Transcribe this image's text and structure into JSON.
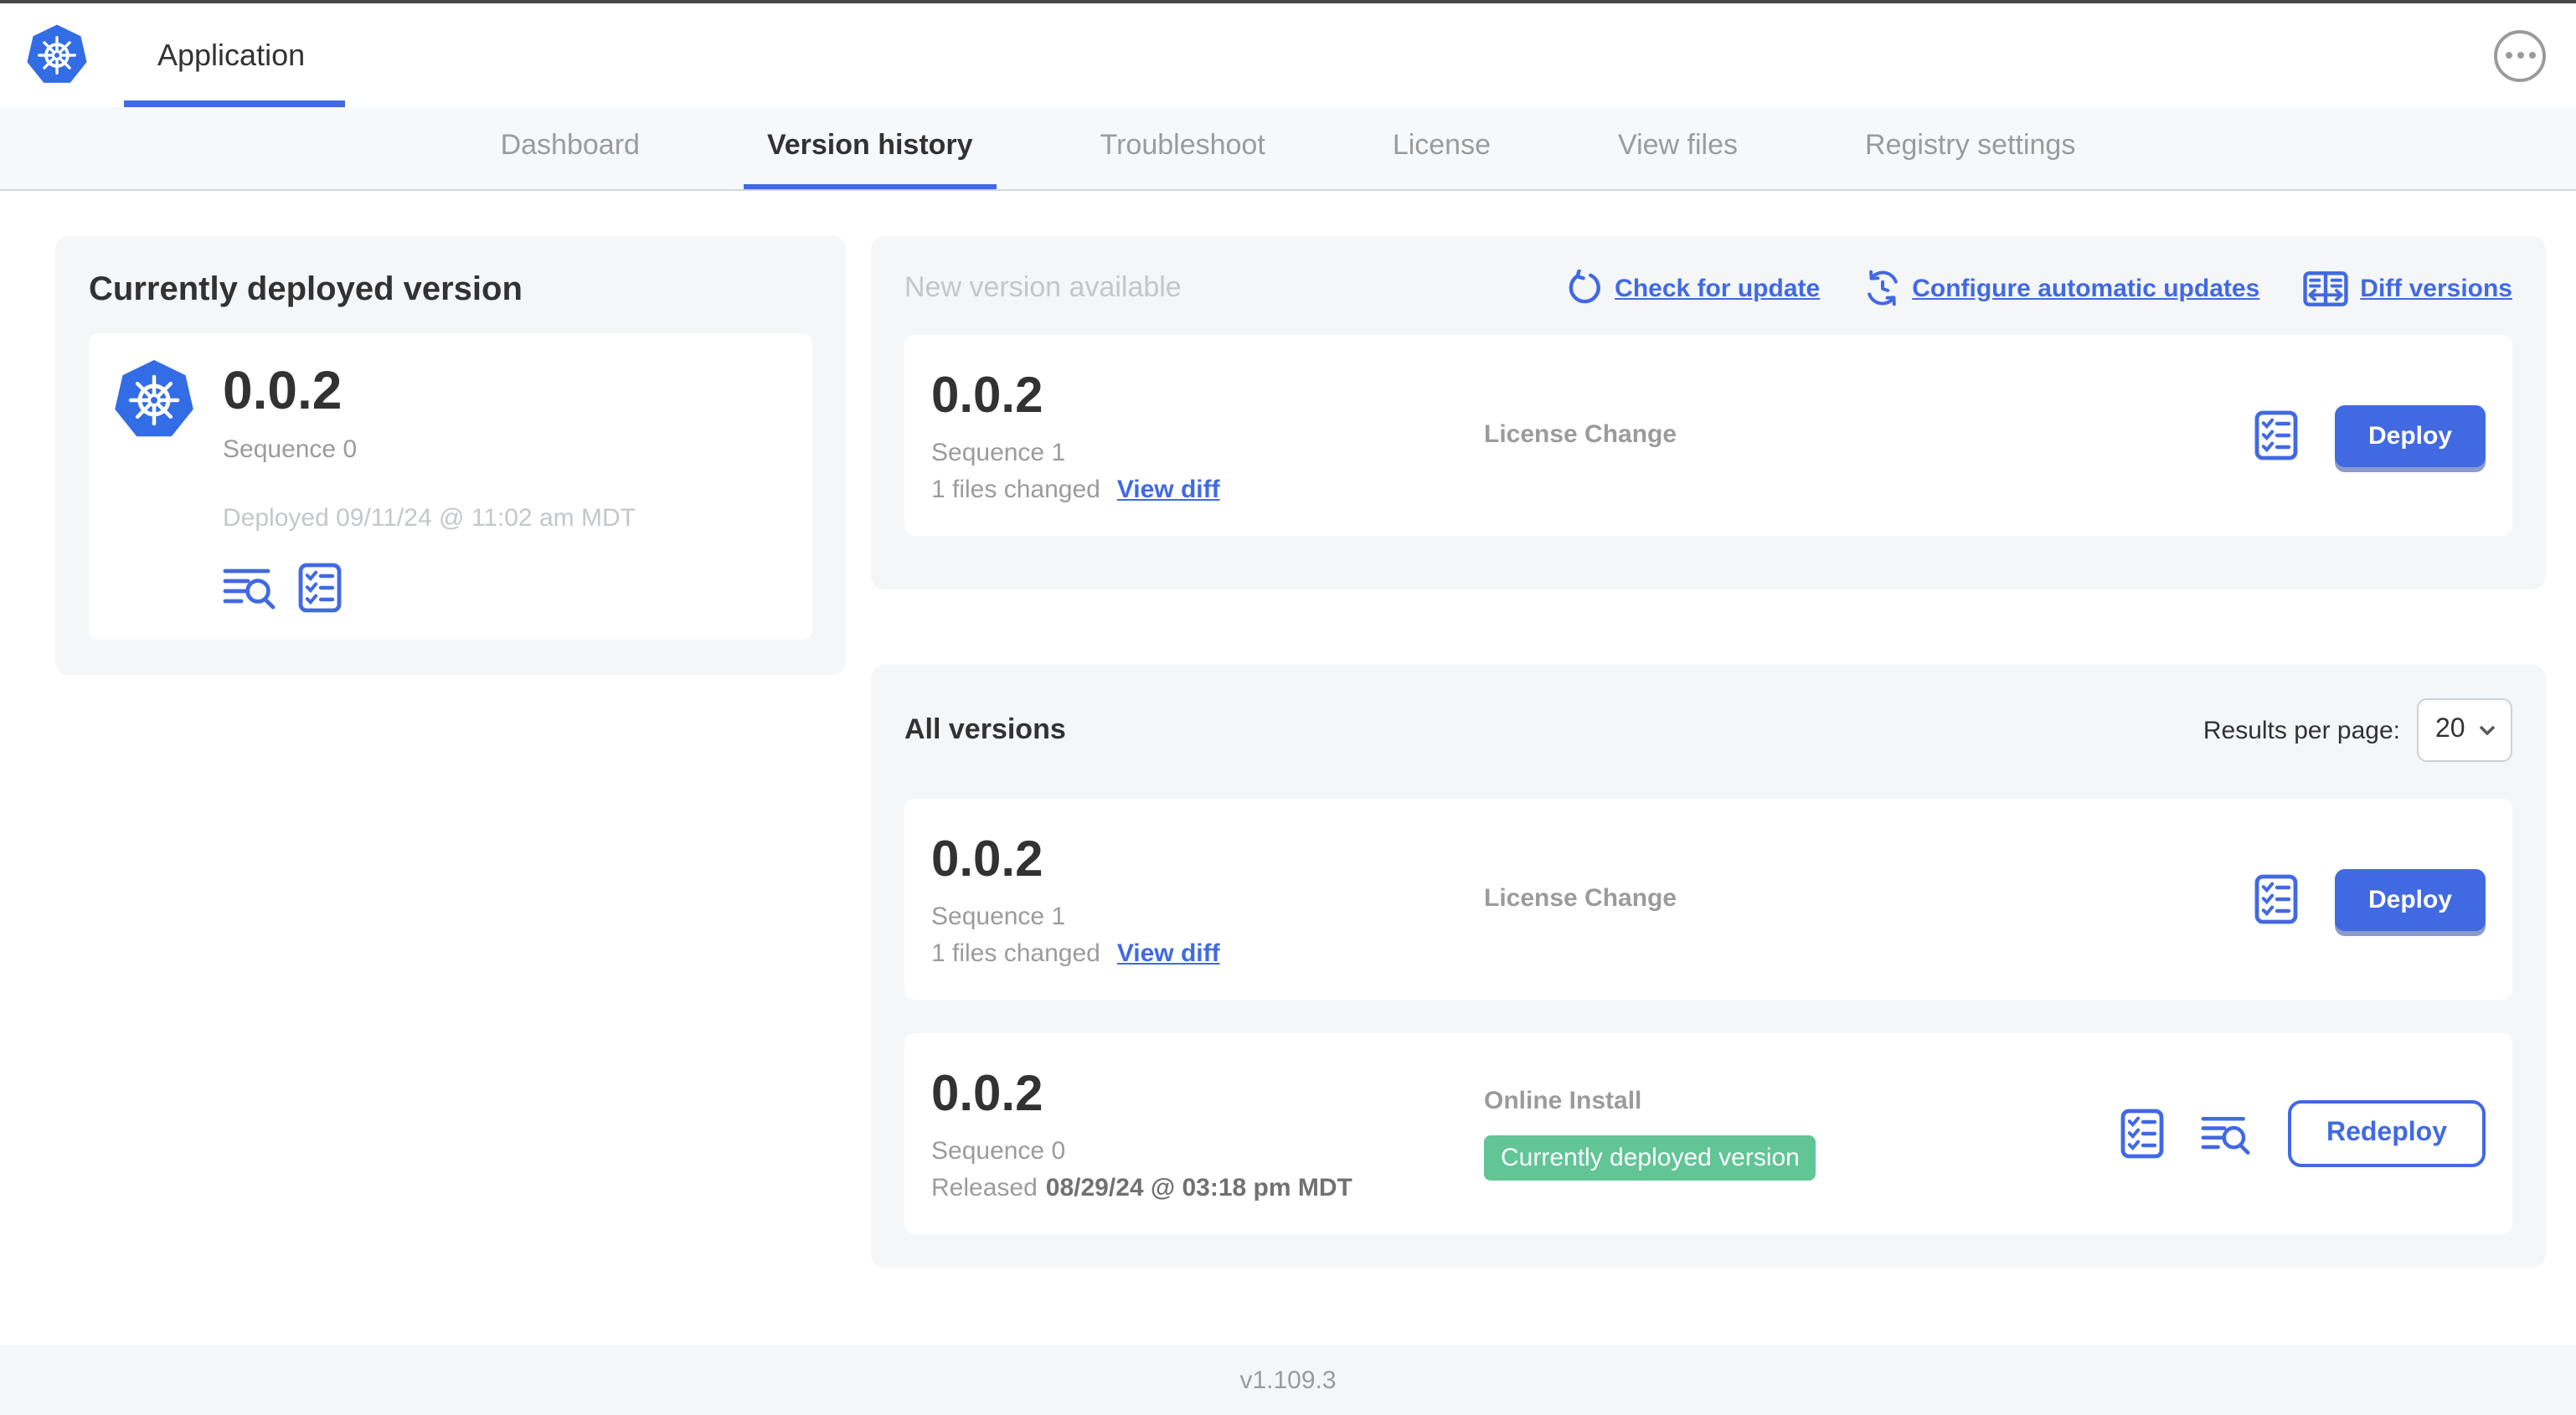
{
  "app": {
    "title": "Application"
  },
  "header": {
    "more_menu_icon": "ellipsis-icon"
  },
  "nav": {
    "active_tab": "Version history",
    "tabs": [
      {
        "label": "Dashboard"
      },
      {
        "label": "Version history"
      },
      {
        "label": "Troubleshoot"
      },
      {
        "label": "License"
      },
      {
        "label": "View files"
      },
      {
        "label": "Registry settings"
      }
    ]
  },
  "current_version": {
    "heading": "Currently deployed version",
    "version": "0.0.2",
    "sequence": "Sequence 0",
    "deployed": "Deployed 09/11/24 @ 11:02 am MDT",
    "icons": [
      "view-logs-icon",
      "config-checklist-icon"
    ]
  },
  "new_version": {
    "heading": "New version available",
    "actions": [
      {
        "label": "Check for update",
        "icon": "refresh-icon"
      },
      {
        "label": "Configure automatic updates",
        "icon": "schedule-icon"
      },
      {
        "label": "Diff versions",
        "icon": "diff-icon"
      }
    ],
    "card": {
      "version": "0.0.2",
      "sequence": "Sequence 1",
      "files_changed": "1 files changed",
      "view_diff_label": "View diff",
      "source": "License Change",
      "action_label": "Deploy",
      "icons": [
        "config-checklist-icon"
      ]
    }
  },
  "all_versions": {
    "heading": "All versions",
    "results_per_page_label": "Results per page:",
    "results_per_page_value": "20",
    "rows": [
      {
        "version": "0.0.2",
        "sequence": "Sequence 1",
        "files_changed": "1 files changed",
        "view_diff_label": "View diff",
        "source": "License Change",
        "action_label": "Deploy",
        "icons": [
          "config-checklist-icon"
        ]
      },
      {
        "version": "0.0.2",
        "sequence": "Sequence 0",
        "released_prefix": "Released",
        "released_date": "08/29/24 @ 03:18 pm MDT",
        "source": "Online Install",
        "status_badge": "Currently deployed version",
        "action_label": "Redeploy",
        "icons": [
          "config-checklist-icon",
          "view-logs-icon"
        ]
      }
    ]
  },
  "footer": {
    "app_version": "v1.109.3"
  },
  "colors": {
    "accent_blue": "#4169e2",
    "k8s_blue": "#326de6",
    "badge_green": "#61c596",
    "panel_gray": "#f5f6f8",
    "dark_text": "#323232",
    "gray_text": "#9b9b9b",
    "light_gray_text": "#c3c7ca"
  }
}
